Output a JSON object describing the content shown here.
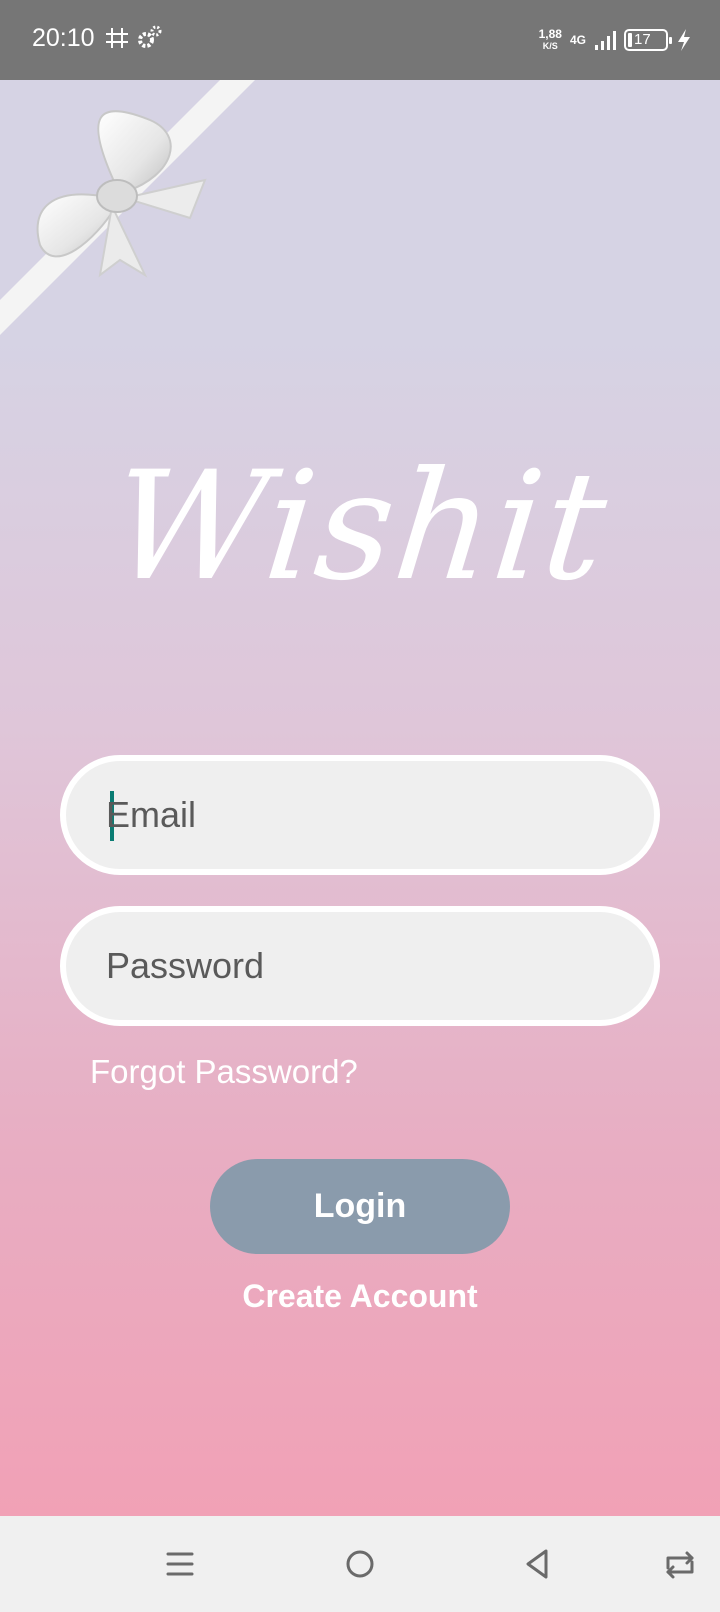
{
  "status_bar": {
    "time": "20:10",
    "net_speed_value": "1,88",
    "net_speed_unit": "K/S",
    "network_type": "4G",
    "battery_level": "17",
    "icons": [
      "grid-notification-icon",
      "settings-notification-icon",
      "signal-icon",
      "battery-icon",
      "charging-icon"
    ]
  },
  "app": {
    "logo_text": "Wishit",
    "email": {
      "value": "",
      "placeholder": "Email"
    },
    "password": {
      "value": "",
      "placeholder": "Password"
    },
    "forgot_password": "Forgot Password?",
    "login_label": "Login",
    "create_account": "Create Account"
  },
  "nav_bar": {
    "icons": [
      "menu-icon",
      "home-icon",
      "back-icon",
      "rotate-icon"
    ]
  },
  "colors": {
    "status_bar": "#767676",
    "gradient_top": "#d6d3e4",
    "gradient_bottom": "#f1a1b6",
    "field_background": "#efefef",
    "login_button": "#8a9bac",
    "caret": "#0a7c73"
  }
}
